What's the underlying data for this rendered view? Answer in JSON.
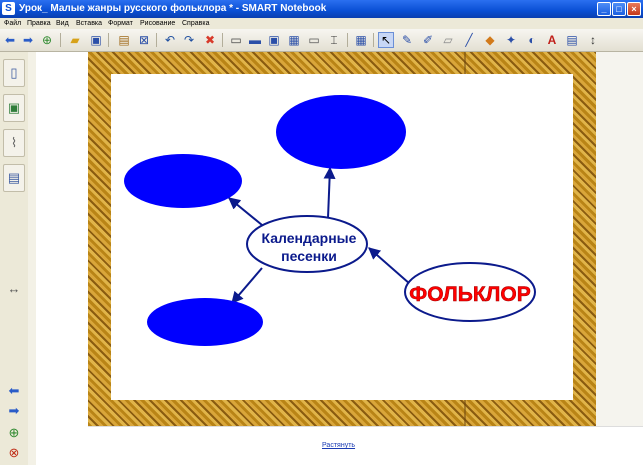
{
  "window": {
    "title": "Урок_ Малые жанры русского фольклора * - SMART Notebook",
    "buttons": [
      "_",
      "□",
      "×"
    ]
  },
  "menu": [
    "Файл",
    "Правка",
    "Вид",
    "Вставка",
    "Формат",
    "Рисование",
    "Справка"
  ],
  "toolbar": {
    "icons": [
      "back-icon",
      "forward-icon",
      "add-page-icon",
      "open-icon",
      "save-icon",
      "paste-icon",
      "delete-page-icon",
      "undo-icon",
      "redo-icon",
      "delete-icon",
      "screen-shade-icon",
      "display-icon",
      "capture-icon",
      "capture-area-icon",
      "document-camera-icon",
      "dual-page-icon",
      "table-icon",
      "select-icon",
      "pen-icon",
      "creative-pen-icon",
      "eraser-icon",
      "line-icon",
      "shape-icon",
      "magic-pen-icon",
      "fill-icon",
      "text-icon",
      "properties-icon",
      "more-icon"
    ]
  },
  "sidebar": {
    "icons": [
      "page-sorter-icon",
      "gallery-icon",
      "attachments-icon",
      "properties-icon",
      "resize-icon",
      "back-icon",
      "forward-icon",
      "add-icon",
      "delete-icon"
    ]
  },
  "slide": {
    "center_label_line1": "Календарные",
    "center_label_line2": "песенки",
    "folklore_label": "ФОЛЬКЛОР"
  },
  "footer": {
    "link": "Растянуть"
  },
  "colors": {
    "ellipse_fill": "#0000ff",
    "folklore_text": "#ff0000",
    "outline": "#0b1a8c"
  }
}
